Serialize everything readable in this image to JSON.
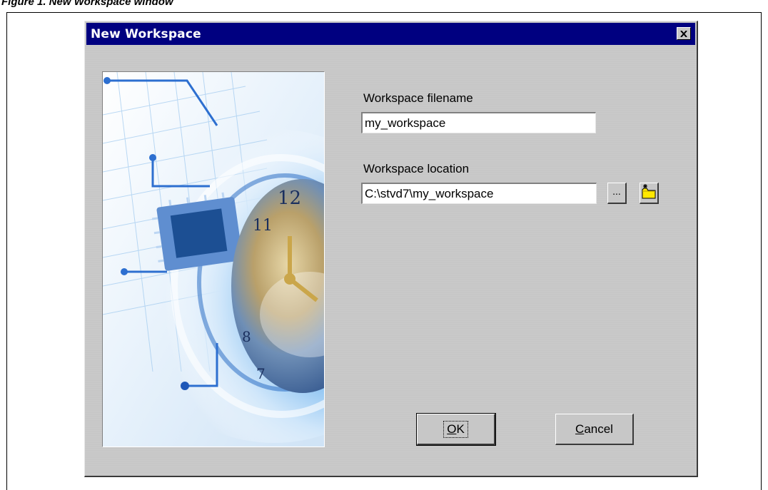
{
  "figure": {
    "caption": "Figure 1.     New Workspace window"
  },
  "window": {
    "title": "New Workspace",
    "close_icon": "close-x-icon"
  },
  "form": {
    "filename_label": "Workspace filename",
    "filename_value": "my_workspace",
    "location_label": "Workspace location",
    "location_value": "C:\\stvd7\\my_workspace",
    "browse_label": "...",
    "new_folder_icon": "new-folder-icon"
  },
  "buttons": {
    "ok_accel": "O",
    "ok_rest": "K",
    "cancel_accel": "C",
    "cancel_rest": "ancel"
  },
  "illustration": {
    "description_icon": "circuit-globe-clock-illustration"
  },
  "colors": {
    "titlebar": "#000080",
    "dialog_face": "#c7c7c7",
    "folder": "#ffe800"
  }
}
